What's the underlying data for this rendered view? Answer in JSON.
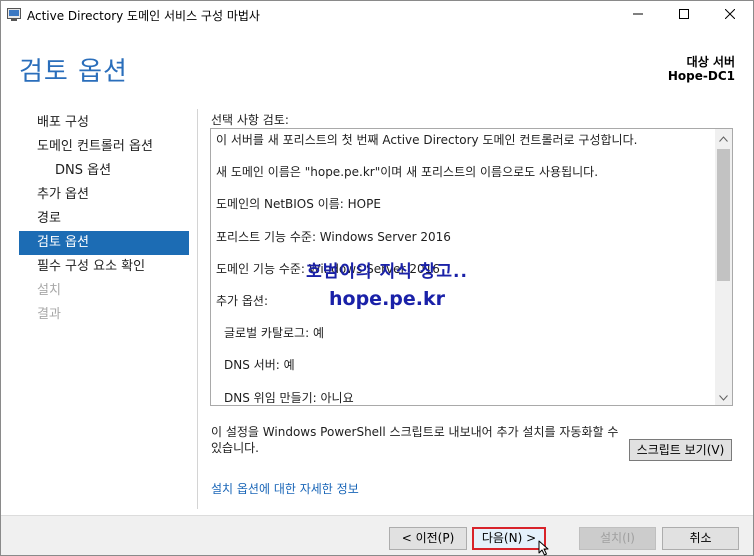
{
  "window": {
    "title": "Active Directory 도메인 서비스 구성 마법사",
    "icons": {
      "app": "ad-wizard-icon",
      "minimize": "minimize-icon",
      "maximize": "maximize-icon",
      "close": "close-icon"
    }
  },
  "header": {
    "page_title": "검토 옵션",
    "target_label": "대상 서버",
    "target_name": "Hope-DC1"
  },
  "nav": {
    "items": [
      {
        "label": "배포 구성",
        "state": "normal"
      },
      {
        "label": "도메인 컨트롤러 옵션",
        "state": "normal"
      },
      {
        "label": "DNS 옵션",
        "state": "sub"
      },
      {
        "label": "추가 옵션",
        "state": "normal"
      },
      {
        "label": "경로",
        "state": "normal"
      },
      {
        "label": "검토 옵션",
        "state": "active"
      },
      {
        "label": "필수 구성 요소 확인",
        "state": "normal"
      },
      {
        "label": "설치",
        "state": "disabled"
      },
      {
        "label": "결과",
        "state": "disabled"
      }
    ]
  },
  "review": {
    "label": "선택 사항 검토:",
    "lines": [
      {
        "text": "이 서버를 새 포리스트의 첫 번째 Active Directory 도메인 컨트롤러로 구성합니다.",
        "indent": false
      },
      {
        "text": "새 도메인 이름은 \"hope.pe.kr\"이며 새 포리스트의 이름으로도 사용됩니다.",
        "indent": false
      },
      {
        "text": "도메인의 NetBIOS 이름: HOPE",
        "indent": false
      },
      {
        "text": "포리스트 기능 수준: Windows Server 2016",
        "indent": false
      },
      {
        "text": "도메인 기능 수준: Windows Server 2016",
        "indent": false
      },
      {
        "text": "추가 옵션:",
        "indent": false
      },
      {
        "text": "글로벌 카탈로그: 예",
        "indent": true
      },
      {
        "text": "DNS 서버: 예",
        "indent": true
      },
      {
        "text": "DNS 위임 만들기: 아니요",
        "indent": true
      }
    ]
  },
  "watermark": {
    "line1": "호범이의 지식 창고..",
    "line2": "hope.pe.kr"
  },
  "export": {
    "text": "이 설정을 Windows PowerShell 스크립트로 내보내어 추가 설치를 자동화할 수 있습니다.",
    "button": "스크립트 보기(V)"
  },
  "more_info_link": "설치 옵션에 대한 자세한 정보",
  "footer": {
    "prev": "< 이전(P)",
    "next": "다음(N) >",
    "install": "설치(I)",
    "cancel": "취소"
  },
  "colors": {
    "accent": "#2a6ebb",
    "nav_active": "#1c6cb4",
    "highlight_border": "#d8232a",
    "watermark": "#1a21a8",
    "link": "#1a66b8"
  }
}
